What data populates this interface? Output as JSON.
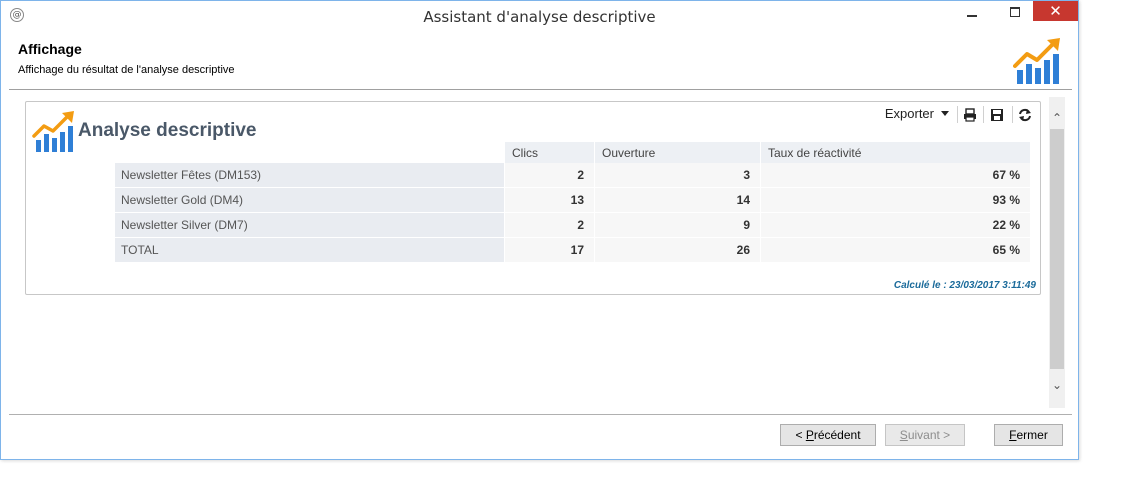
{
  "window": {
    "title": "Assistant d'analyse descriptive",
    "close_glyph": "✕",
    "app_icon": "app-icon"
  },
  "header": {
    "title": "Affichage",
    "subtitle": "Affichage du résultat de l'analyse descriptive",
    "logo_icon": "chart-growth-icon"
  },
  "toolbar": {
    "export_label": "Exporter",
    "icons": [
      "dropdown-caret-icon",
      "print-icon",
      "save-icon",
      "refresh-icon"
    ]
  },
  "report": {
    "title": "Analyse descriptive",
    "columns": [
      "Clics",
      "Ouverture",
      "Taux de réactivité"
    ],
    "rows": [
      {
        "label": "Newsletter Fêtes (DM153)",
        "clics": "2",
        "ouverture": "3",
        "taux": "67 %"
      },
      {
        "label": "Newsletter Gold (DM4)",
        "clics": "13",
        "ouverture": "14",
        "taux": "93 %"
      },
      {
        "label": "Newsletter Silver (DM7)",
        "clics": "2",
        "ouverture": "9",
        "taux": "22 %"
      },
      {
        "label": "TOTAL",
        "clics": "17",
        "ouverture": "26",
        "taux": "65 %"
      }
    ],
    "computed": "Calculé le : 23/03/2017 3:11:49"
  },
  "scroll": {
    "up": "⌃",
    "down": "⌄"
  },
  "buttons": {
    "prev_prefix": "< ",
    "prev_mnemonic": "P",
    "prev_rest": "récédent",
    "next_mnemonic": "S",
    "next_rest": "uivant >",
    "close_mnemonic": "F",
    "close_rest": "ermer"
  },
  "colors": {
    "accent_orange": "#f39c12",
    "accent_blue": "#2f7fd6",
    "title_text": "#4a5868",
    "computed_text": "#1a6a9a",
    "close_red": "#c7372f"
  }
}
